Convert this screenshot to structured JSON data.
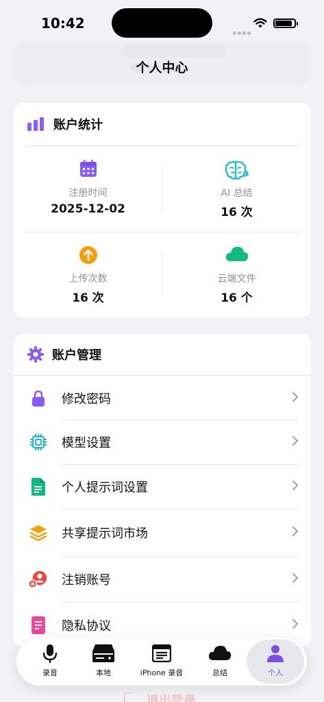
{
  "status_bar": {
    "time": "10:42"
  },
  "ghost_header": {
    "id_text": "ID 10173"
  },
  "page_title": "个人中心",
  "stats_card": {
    "title": "账户统计",
    "items": [
      {
        "label": "注册时间",
        "value": "2025-12-02",
        "icon": "calendar-icon",
        "color": "#8b5cf6"
      },
      {
        "label": "AI 总结",
        "value": "16 次",
        "icon": "brain-icon",
        "color": "#22b8cf"
      },
      {
        "label": "上传次数",
        "value": "16 次",
        "icon": "upload-arrow-icon",
        "color": "#f59e0b"
      },
      {
        "label": "云端文件",
        "value": "16 个",
        "icon": "cloud-icon",
        "color": "#10b981"
      }
    ]
  },
  "management_card": {
    "title": "账户管理",
    "items": [
      {
        "label": "修改密码",
        "icon": "lock-icon",
        "color": "#8b5cf6"
      },
      {
        "label": "模型设置",
        "icon": "chip-icon",
        "color": "#22b8cf"
      },
      {
        "label": "个人提示词设置",
        "icon": "document-icon",
        "color": "#10b981"
      },
      {
        "label": "共享提示词市场",
        "icon": "layers-icon",
        "color": "#f59e0b"
      },
      {
        "label": "注销账号",
        "icon": "remove-user-icon",
        "color": "#ef4444"
      },
      {
        "label": "隐私协议",
        "icon": "privacy-doc-icon",
        "color": "#ec4899"
      }
    ]
  },
  "logout_label": "退出登录",
  "tab_bar": {
    "tabs": [
      {
        "label": "录音",
        "icon": "microphone-icon"
      },
      {
        "label": "本地",
        "icon": "local-drive-icon"
      },
      {
        "label": "iPhone 录音",
        "icon": "recording-list-icon"
      },
      {
        "label": "总结",
        "icon": "cloud-summary-icon"
      },
      {
        "label": "个人",
        "icon": "person-icon",
        "active": true
      }
    ]
  },
  "colors": {
    "accent": "#7b4fe0",
    "background": "#f2f2f6"
  }
}
